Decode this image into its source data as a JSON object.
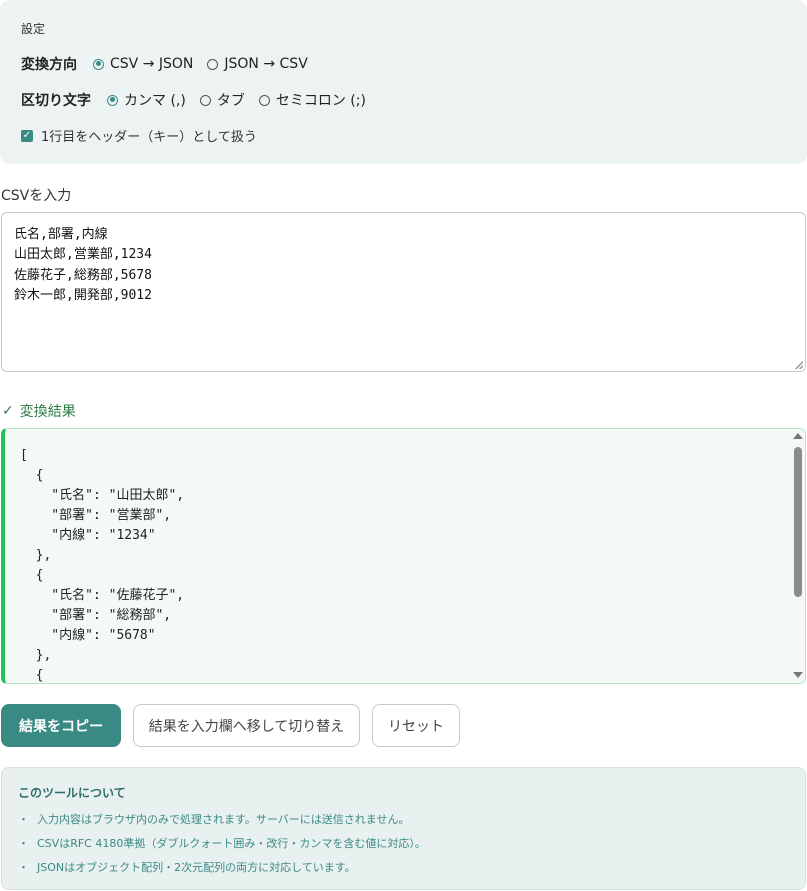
{
  "settings": {
    "title": "設定",
    "direction": {
      "label": "変換方向",
      "options": [
        "CSV → JSON",
        "JSON → CSV"
      ],
      "selected": "CSV → JSON"
    },
    "delimiter": {
      "label": "区切り文字",
      "options": [
        "カンマ (,)",
        "タブ",
        "セミコロン (;)"
      ],
      "selected": "カンマ (,)"
    },
    "header_checkbox": {
      "label": "1行目をヘッダー（キー）として扱う",
      "checked": true
    }
  },
  "input": {
    "label": "CSVを入力",
    "value": "氏名,部署,内線\n山田太郎,営業部,1234\n佐藤花子,総務部,5678\n鈴木一郎,開発部,9012"
  },
  "result": {
    "label": "変換結果",
    "check_mark": "✓",
    "text": "[\n  {\n    \"氏名\": \"山田太郎\",\n    \"部署\": \"営業部\",\n    \"内線\": \"1234\"\n  },\n  {\n    \"氏名\": \"佐藤花子\",\n    \"部署\": \"総務部\",\n    \"内線\": \"5678\"\n  },\n  {"
  },
  "buttons": {
    "copy": "結果をコピー",
    "move": "結果を入力欄へ移して切り替え",
    "reset": "リセット"
  },
  "about": {
    "title": "このツールについて",
    "bullet": "・",
    "items": [
      "入力内容はブラウザ内のみで処理されます。サーバーには送信されません。",
      "CSVはRFC 4180準拠（ダブルクォート囲み・改行・カンマを含む値に対応）。",
      "JSONはオブジェクト配列・2次元配列の両方に対応しています。"
    ]
  },
  "colors": {
    "accent": "#3a8a84",
    "success": "#22c05a",
    "result_bg": "#f3faf5",
    "panel_bg": "#edf3f3"
  }
}
